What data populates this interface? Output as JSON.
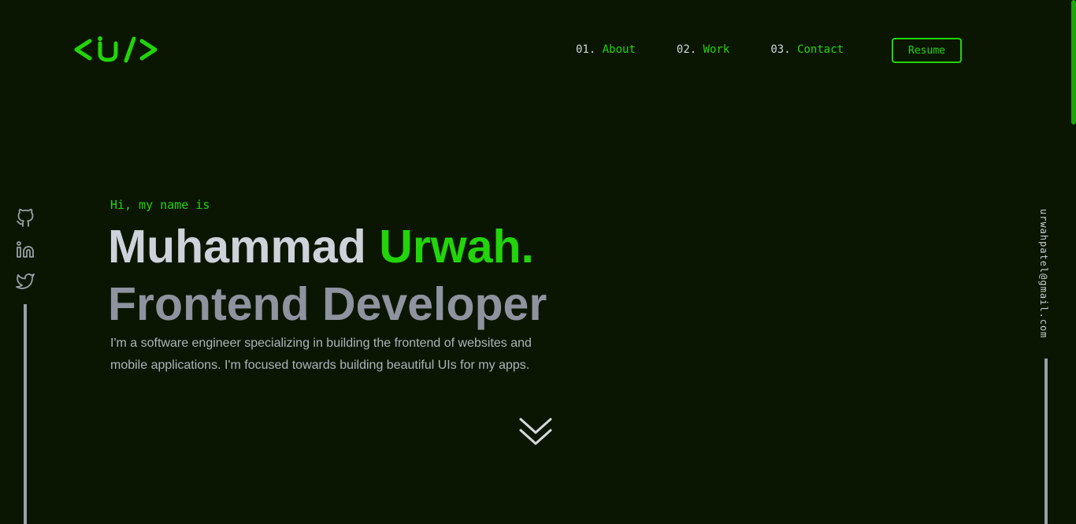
{
  "logo": {
    "text": "<U/>",
    "color": "#22d40a"
  },
  "nav": {
    "items": [
      {
        "num": "01.",
        "label": "About"
      },
      {
        "num": "02.",
        "label": "Work"
      },
      {
        "num": "03.",
        "label": "Contact"
      }
    ],
    "resume_label": "Resume"
  },
  "hero": {
    "greeting": "Hi, my name is",
    "name_first": "Muhammad",
    "name_highlight": "Urwah.",
    "role": "Frontend Developer",
    "bio": "I'm a software engineer specializing in building the frontend of websites and mobile applications. I'm focused towards building beautiful UIs for my apps."
  },
  "social": {
    "icons": [
      "github-icon",
      "linkedin-icon",
      "twitter-icon"
    ]
  },
  "email": "urwahpatel@gmail.com",
  "colors": {
    "background": "#0b1602",
    "accent": "#22d40a",
    "text_light": "#ced2da",
    "text_muted": "#8e939f"
  }
}
